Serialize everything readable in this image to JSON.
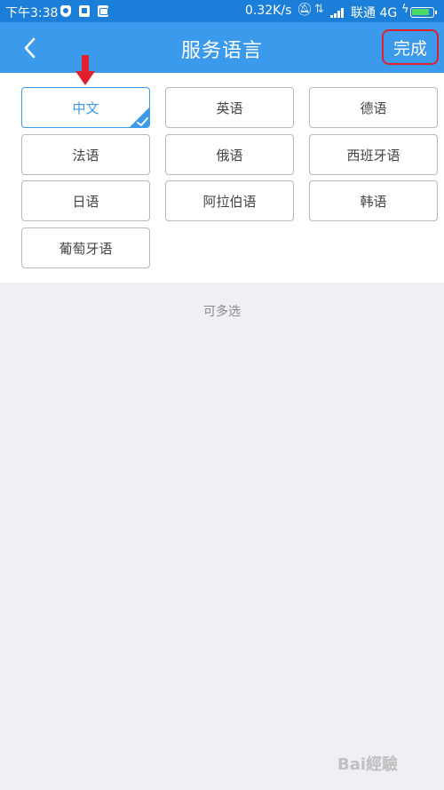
{
  "status_bar": {
    "time": "下午3:38",
    "speed": "0.32K/s",
    "carrier": "联通 4G",
    "battery_level": 0.85,
    "icons": [
      "shield-icon",
      "app-icon",
      "app-icon",
      "mute-bell-icon",
      "signal-icon",
      "charging-icon",
      "battery-icon"
    ]
  },
  "nav": {
    "title": "服务语言",
    "back_icon": "chevron-left-icon",
    "done_label": "完成"
  },
  "languages": [
    {
      "label": "中文",
      "selected": true
    },
    {
      "label": "英语",
      "selected": false
    },
    {
      "label": "德语",
      "selected": false
    },
    {
      "label": "法语",
      "selected": false
    },
    {
      "label": "俄语",
      "selected": false
    },
    {
      "label": "西班牙语",
      "selected": false
    },
    {
      "label": "日语",
      "selected": false
    },
    {
      "label": "阿拉伯语",
      "selected": false
    },
    {
      "label": "韩语",
      "selected": false
    },
    {
      "label": "葡萄牙语",
      "selected": false
    }
  ],
  "hint": "可多选",
  "colors": {
    "primary": "#3b9aec",
    "status_bar": "#1b7ed8",
    "annotation_red": "#e0202c",
    "background": "#f0eff5"
  }
}
